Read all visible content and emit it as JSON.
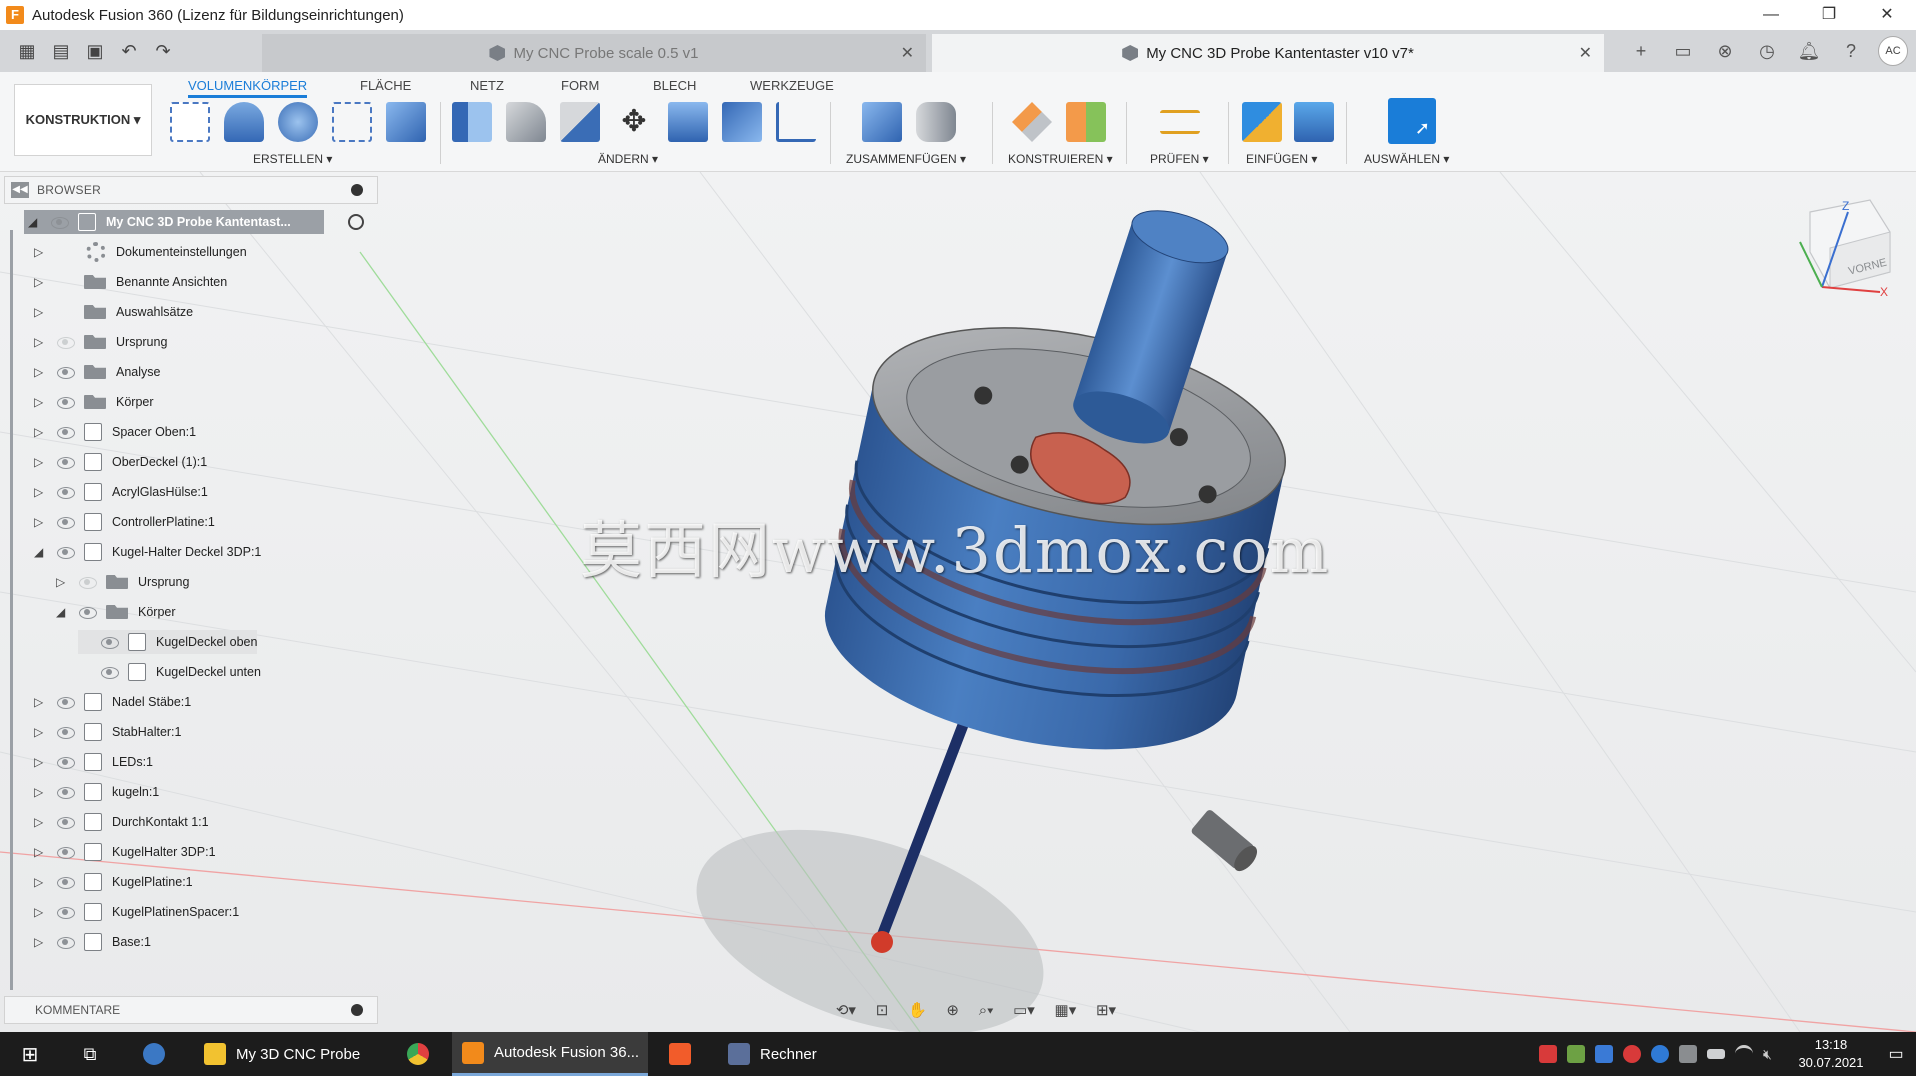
{
  "window": {
    "title": "Autodesk Fusion 360 (Lizenz für Bildungseinrichtungen)",
    "controls": [
      "—",
      "❐",
      "✕"
    ]
  },
  "tabs": [
    {
      "label": "My CNC Probe scale 0.5 v1",
      "active": false
    },
    {
      "label": "My CNC 3D Probe Kantentaster v10 v7*",
      "active": true
    }
  ],
  "user_initials": "AC",
  "toolbar": {
    "workspace": "KONSTRUKTION ▾",
    "workspace_tabs": [
      "VOLUMENKÖRPER",
      "FLÄCHE",
      "NETZ",
      "FORM",
      "BLECH",
      "WERKZEUGE"
    ],
    "groups": [
      "ERSTELLEN ▾",
      "ÄNDERN ▾",
      "ZUSAMMENFÜGEN ▾",
      "KONSTRUIEREN ▾",
      "PRÜFEN ▾",
      "EINFÜGEN ▾",
      "AUSWÄHLEN ▾"
    ]
  },
  "browser": {
    "title": "BROWSER",
    "root": "My CNC 3D Probe Kantentast...",
    "items": [
      {
        "label": "Dokumenteinstellungen",
        "icon": "gear",
        "eye": false,
        "expanded": false,
        "level": 1
      },
      {
        "label": "Benannte Ansichten",
        "icon": "folder",
        "eye": false,
        "expanded": false,
        "level": 1
      },
      {
        "label": "Auswahlsätze",
        "icon": "folder",
        "eye": false,
        "expanded": false,
        "level": 1
      },
      {
        "label": "Ursprung",
        "icon": "folder",
        "eye": "off",
        "expanded": false,
        "level": 1
      },
      {
        "label": "Analyse",
        "icon": "folder",
        "eye": true,
        "expanded": false,
        "level": 1
      },
      {
        "label": "Körper",
        "icon": "folder",
        "eye": true,
        "expanded": false,
        "level": 1
      },
      {
        "label": "Spacer Oben:1",
        "icon": "body",
        "eye": true,
        "expanded": false,
        "level": 1
      },
      {
        "label": "OberDeckel (1):1",
        "icon": "body",
        "eye": true,
        "expanded": false,
        "level": 1
      },
      {
        "label": "AcrylGlasHülse:1",
        "icon": "body",
        "eye": true,
        "expanded": false,
        "level": 1
      },
      {
        "label": "ControllerPlatine:1",
        "icon": "body",
        "eye": true,
        "expanded": false,
        "level": 1
      },
      {
        "label": "Kugel-Halter Deckel 3DP:1",
        "icon": "body",
        "eye": true,
        "expanded": true,
        "level": 1
      },
      {
        "label": "Ursprung",
        "icon": "folder",
        "eye": "off",
        "expanded": false,
        "level": 2
      },
      {
        "label": "Körper",
        "icon": "folder",
        "eye": true,
        "expanded": true,
        "level": 2
      },
      {
        "label": "KugelDeckel oben",
        "icon": "body",
        "eye": true,
        "expanded": null,
        "level": 3
      },
      {
        "label": "KugelDeckel unten",
        "icon": "body",
        "eye": true,
        "expanded": null,
        "level": 3
      },
      {
        "label": "Nadel Stäbe:1",
        "icon": "body",
        "eye": true,
        "expanded": false,
        "level": 1
      },
      {
        "label": "StabHalter:1",
        "icon": "body",
        "eye": true,
        "expanded": false,
        "level": 1
      },
      {
        "label": "LEDs:1",
        "icon": "body",
        "eye": true,
        "expanded": false,
        "level": 1
      },
      {
        "label": "kugeln:1",
        "icon": "body",
        "eye": true,
        "expanded": false,
        "level": 1
      },
      {
        "label": "DurchKontakt 1:1",
        "icon": "body",
        "eye": true,
        "expanded": false,
        "level": 1
      },
      {
        "label": "KugelHalter 3DP:1",
        "icon": "body",
        "eye": true,
        "expanded": false,
        "level": 1
      },
      {
        "label": "KugelPlatine:1",
        "icon": "body",
        "eye": true,
        "expanded": false,
        "level": 1
      },
      {
        "label": "KugelPlatinenSpacer:1",
        "icon": "body",
        "eye": true,
        "expanded": false,
        "level": 1
      },
      {
        "label": "Base:1",
        "icon": "body",
        "eye": true,
        "expanded": false,
        "level": 1
      }
    ]
  },
  "comments": {
    "title": "KOMMENTARE"
  },
  "viewcube": {
    "face": "VORNE"
  },
  "watermark": "莫西网www.3dmox.com",
  "taskbar": {
    "items": [
      "My 3D CNC Probe",
      "Autodesk Fusion 36...",
      "Rechner"
    ],
    "time": "13:18",
    "date": "30.07.2021"
  },
  "colors": {
    "accent": "#1a7dd8",
    "model_blue": "#3f6fae",
    "model_gray": "#8a8d90",
    "pcb_red": "#c8614f"
  }
}
